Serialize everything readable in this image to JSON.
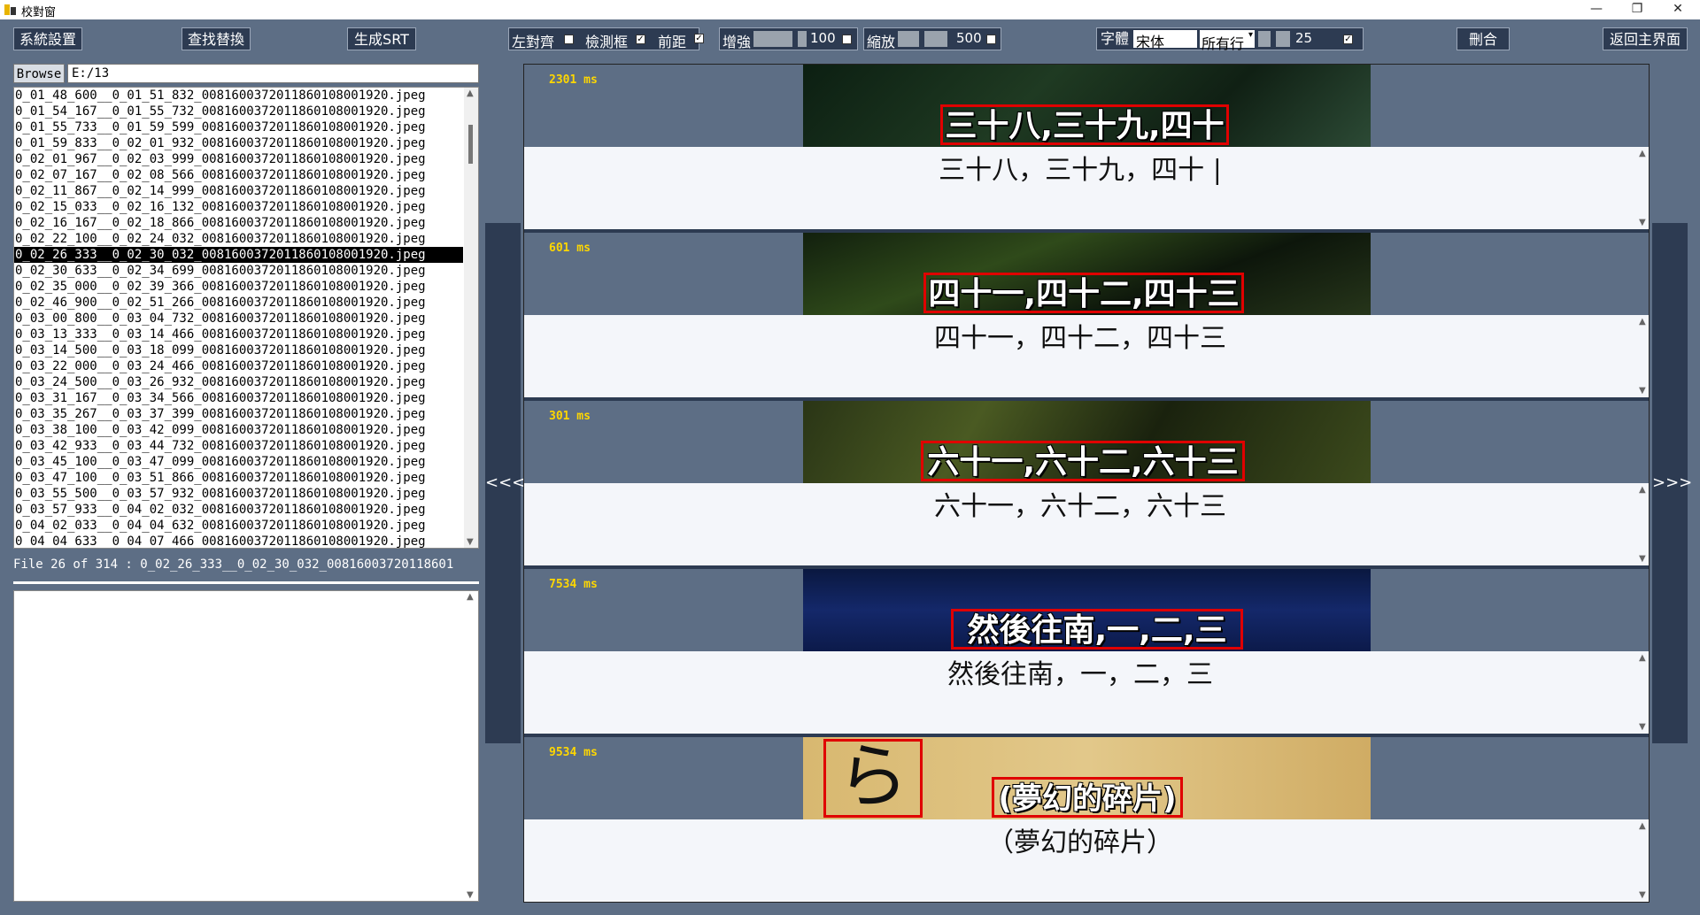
{
  "window": {
    "title": "校對窗"
  },
  "toolbar": {
    "settings": "系統設置",
    "find_replace": "查找替換",
    "generate_srt": "生成SRT",
    "left_align": "左對齊",
    "left_align_checked": false,
    "detect_box": "檢測框",
    "detect_box_checked": true,
    "front_distance": "前距",
    "front_distance_checked": true,
    "enhance": "增強",
    "enhance_value": "100",
    "enhance_checked": false,
    "zoom": "縮放",
    "zoom_value": "500",
    "zoom_checked": false,
    "font_label": "字體",
    "font_value": "宋体",
    "lines_select": "所有行",
    "size_value": "25",
    "size_checked": true,
    "delete_merge": "刪合",
    "back_main": "返回主界面"
  },
  "left_panel": {
    "browse_label": "Browse",
    "path": "E:/13",
    "files": [
      "0_01_48_600__0_01_51_832_0081600372011860108001920.jpeg",
      "0_01_54_167__0_01_55_732_0081600372011860108001920.jpeg",
      "0_01_55_733__0_01_59_599_0081600372011860108001920.jpeg",
      "0_01_59_833__0_02_01_932_0081600372011860108001920.jpeg",
      "0_02_01_967__0_02_03_999_0081600372011860108001920.jpeg",
      "0_02_07_167__0_02_08_566_0081600372011860108001920.jpeg",
      "0_02_11_867__0_02_14_999_0081600372011860108001920.jpeg",
      "0_02_15_033__0_02_16_132_0081600372011860108001920.jpeg",
      "0_02_16_167__0_02_18_866_0081600372011860108001920.jpeg",
      "0_02_22_100__0_02_24_032_0081600372011860108001920.jpeg",
      "0_02_26_333__0_02_30_032_0081600372011860108001920.jpeg",
      "0_02_30_633__0_02_34_699_0081600372011860108001920.jpeg",
      "0_02_35_000__0_02_39_366_0081600372011860108001920.jpeg",
      "0_02_46_900__0_02_51_266_0081600372011860108001920.jpeg",
      "0_03_00_800__0_03_04_732_0081600372011860108001920.jpeg",
      "0_03_13_333__0_03_14_466_0081600372011860108001920.jpeg",
      "0_03_14_500__0_03_18_099_0081600372011860108001920.jpeg",
      "0_03_22_000__0_03_24_466_0081600372011860108001920.jpeg",
      "0_03_24_500__0_03_26_932_0081600372011860108001920.jpeg",
      "0_03_31_167__0_03_34_566_0081600372011860108001920.jpeg",
      "0_03_35_267__0_03_37_399_0081600372011860108001920.jpeg",
      "0_03_38_100__0_03_42_099_0081600372011860108001920.jpeg",
      "0_03_42_933__0_03_44_732_0081600372011860108001920.jpeg",
      "0_03_45_100__0_03_47_099_0081600372011860108001920.jpeg",
      "0_03_47_100__0_03_51_866_0081600372011860108001920.jpeg",
      "0_03_55_500__0_03_57_932_0081600372011860108001920.jpeg",
      "0_03_57_933__0_04_02_032_0081600372011860108001920.jpeg",
      "0_04_02_033__0_04_04_632_0081600372011860108001920.jpeg",
      "0_04_04_633__0_04_07_466_0081600372011860108001920.jpeg"
    ],
    "selected_index": 10,
    "status": "File 26 of 314 :  0_02_26_333__0_02_30_032_00816003720118601"
  },
  "nav": {
    "prev": "<<<",
    "next": ">>>"
  },
  "cards": [
    {
      "duration": "2301 ms",
      "subtitle_image_text": "三十八,三十九,四十",
      "text": "三十八，三十九，四十 |"
    },
    {
      "duration": "601 ms",
      "subtitle_image_text": "四十一,四十二,四十三",
      "text": "四十一，四十二，四十三"
    },
    {
      "duration": "301 ms",
      "subtitle_image_text": "六十一,六十二,六十三",
      "text": "六十一，六十二，六十三"
    },
    {
      "duration": "7534 ms",
      "subtitle_image_text": "然後往南,一,二,三",
      "text": "然後往南，一，二，三"
    },
    {
      "duration": "9534 ms",
      "subtitle_image_text": "(夢幻的碎片)",
      "text": "（夢幻的碎片）",
      "extra_box_text": "ら"
    }
  ],
  "colors": {
    "background": "#5d6e85",
    "button": "#2d3b52",
    "duration": "#ffd700",
    "detect_box": "#e00000"
  }
}
